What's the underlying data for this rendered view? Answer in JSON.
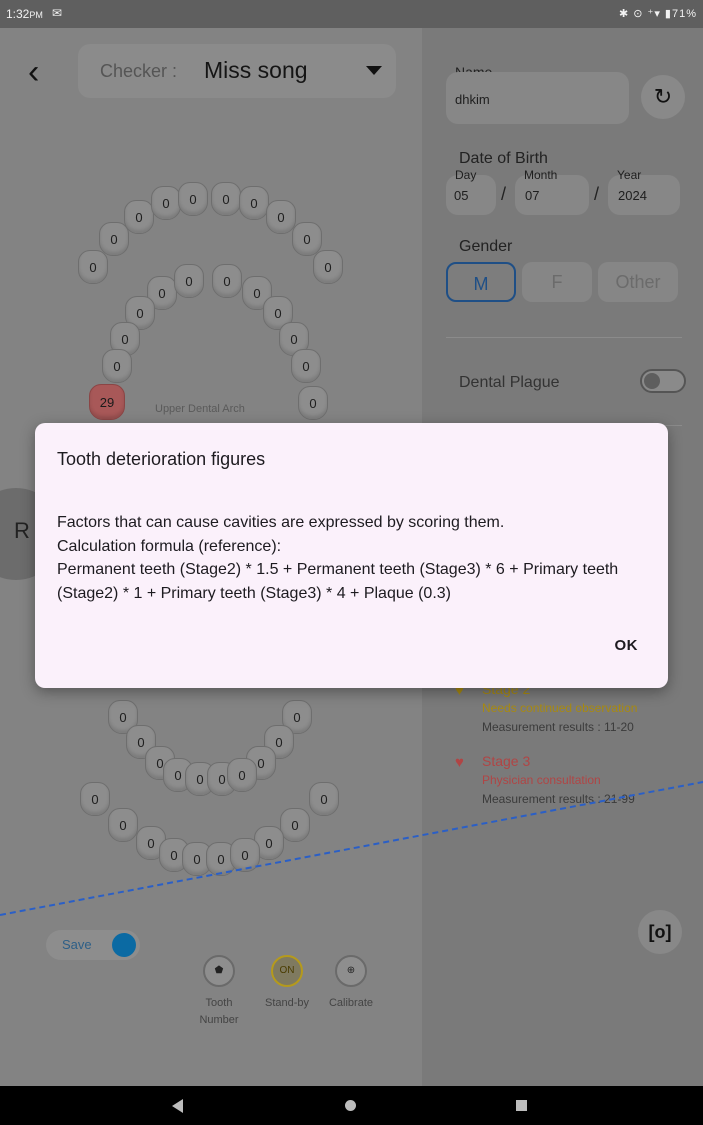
{
  "status_bar": {
    "time": "1:32",
    "ampm": "PM",
    "right": "✱ ⊙ ⁺▾ ▮71%"
  },
  "checker": {
    "label": "Checker :",
    "value": "Miss song"
  },
  "upper_arch": {
    "label": "Upper Dental Arch",
    "highlighted_value": "29",
    "outer": [
      "0",
      "0",
      "0",
      "0",
      "0",
      "0",
      "0",
      "0",
      "0",
      "0",
      "0",
      "0"
    ],
    "inner": [
      "0",
      "0",
      "0",
      "0",
      "0",
      "0",
      "0",
      "0",
      "0",
      "0",
      "0",
      "0"
    ]
  },
  "lower_arch": {
    "outer": [
      "0",
      "0",
      "0",
      "0",
      "0",
      "0",
      "0",
      "0",
      "0",
      "0",
      "0",
      "0"
    ],
    "inner": [
      "0",
      "0",
      "0",
      "0",
      "0",
      "0",
      "0",
      "0",
      "0",
      "0",
      "0",
      "0"
    ]
  },
  "side_tab": {
    "label": "R"
  },
  "save_toggle": {
    "label": "Save",
    "on": true
  },
  "tools": [
    {
      "label": "Tooth Number",
      "icon": "tooth-icon"
    },
    {
      "label": "Stand-by",
      "badge": "ON",
      "icon": "standby-icon"
    },
    {
      "label": "Calibrate",
      "icon": "crosshair-icon"
    }
  ],
  "form": {
    "name_label": "Name",
    "name_value": "dhkim",
    "dob_label": "Date of Birth",
    "day_label": "Day",
    "day_value": "05",
    "month_label": "Month",
    "month_value": "07",
    "year_label": "Year",
    "year_value": "2024",
    "sep": "/",
    "gender_label": "Gender",
    "gender_options": [
      "M",
      "F",
      "Other"
    ],
    "gender_selected": "M",
    "plaque_label": "Dental Plague",
    "plaque_on": false
  },
  "stages": [
    {
      "title": "Stage 2",
      "subtitle": "Needs continued observation",
      "result": "Measurement results : 11-20",
      "color": "#a88a10"
    },
    {
      "title": "Stage 3",
      "subtitle": "Physician consultation",
      "result": "Measurement results : 21-99",
      "color": "#b04545"
    }
  ],
  "dialog": {
    "title": "Tooth deterioration figures",
    "body_line1": "Factors that can cause cavities are expressed by scoring them.",
    "body_line2": "Calculation formula (reference):",
    "body_line3": "Permanent teeth (Stage2) * 1.5 + Permanent teeth (Stage3) * 6 + Primary teeth (Stage2) * 1 + Primary teeth (Stage3) * 4 + Plaque (0.3)",
    "ok_label": "OK"
  },
  "colors": {
    "accent": "#1f4f86",
    "stage2": "#a88a10",
    "stage3": "#b04545",
    "dialog_bg": "#fbf1fb"
  }
}
